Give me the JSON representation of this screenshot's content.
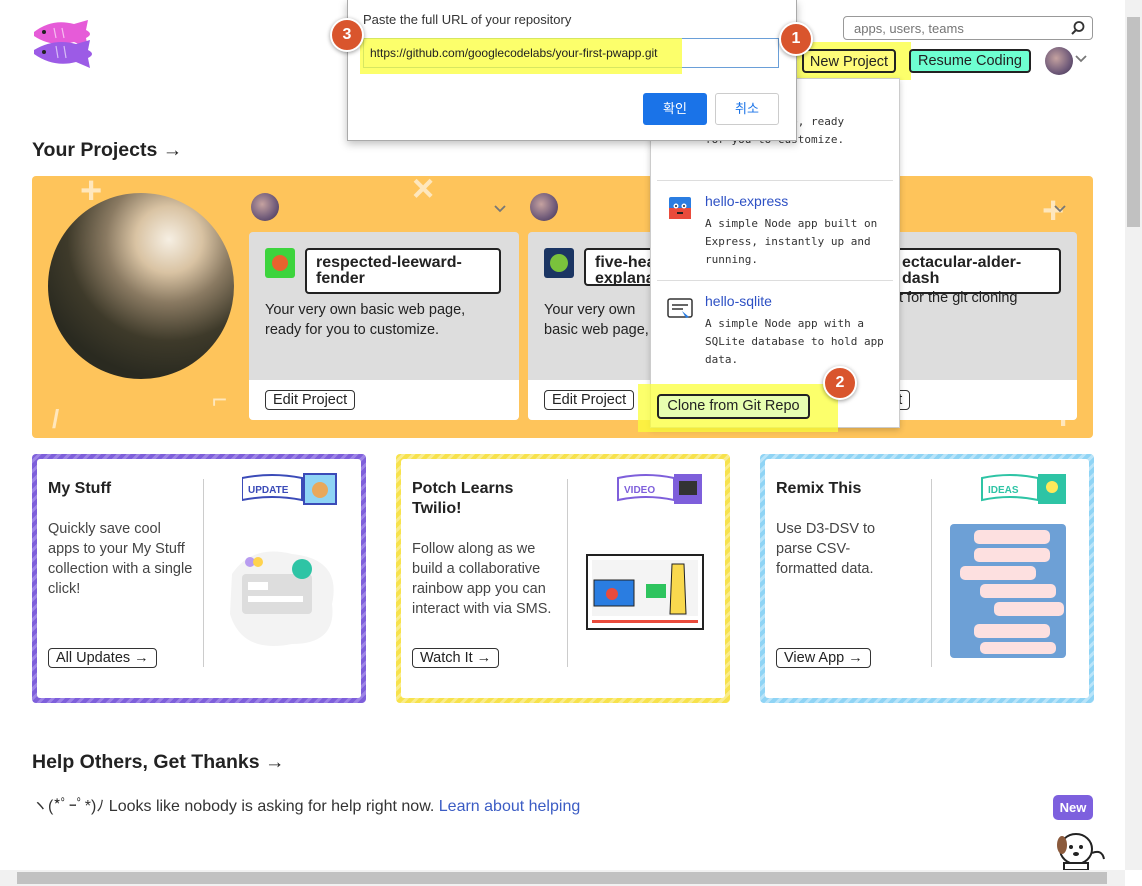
{
  "header": {
    "search_placeholder": "apps, users, teams",
    "new_project_label": "New Project",
    "resume_coding_label": "Resume Coding"
  },
  "dialog": {
    "label": "Paste the full URL of your repository",
    "url_value": "https://github.com/googlecodelabs/your-first-pwapp.git",
    "ok_label": "확인",
    "cancel_label": "취소"
  },
  "badges": [
    "1",
    "2",
    "3"
  ],
  "projects": {
    "title": "Your Projects →",
    "cards": [
      {
        "name": "respected-leeward-fender",
        "desc": "Your very own basic web page, ready for you to customize.",
        "edit_label": "Edit Project"
      },
      {
        "name": "five-hea explana",
        "desc": "Your very own basic web page, ready for you to customize.",
        "edit_label": "Edit Project"
      },
      {
        "name": "ectacular-alder-dash",
        "desc": "t for the git cloning",
        "edit_label": "ct"
      }
    ]
  },
  "menu": {
    "partial_desc": "basic web page, ready for you to customize.",
    "items": [
      {
        "title": "hello-express",
        "desc": "A simple Node app built on Express, instantly up and running."
      },
      {
        "title": "hello-sqlite",
        "desc": "A simple Node app with a SQLite database to hold app data."
      }
    ],
    "clone_label": "Clone from Git Repo"
  },
  "features": [
    {
      "title": "My Stuff",
      "body": "Quickly save cool apps to your My Stuff collection with a single click!",
      "cta": "All Updates →",
      "tag": "UPDATE",
      "color": "#7e5fdb"
    },
    {
      "title": "Potch Learns Twilio!",
      "body": "Follow along as we build a collaborative rainbow app you can interact with via SMS.",
      "cta": "Watch It →",
      "tag": "VIDEO",
      "color": "#f7e24c"
    },
    {
      "title": "Remix This",
      "body": "Use D3-DSV to parse CSV-formatted data.",
      "cta": "View App →",
      "tag": "IDEAS",
      "color": "#8fd4f5"
    }
  ],
  "help": {
    "title": "Help Others, Get Thanks →",
    "text": "ヽ(*ﾟｰﾟ*)ﾉ Looks like nobody is asking for help right now.",
    "link": "Learn about helping"
  },
  "new_badge": "New",
  "colors": {
    "accent_blue": "#1a73e8",
    "band_yellow": "#fec45b",
    "highlight": "#fbff3a",
    "badge_orange": "#d9552d"
  }
}
